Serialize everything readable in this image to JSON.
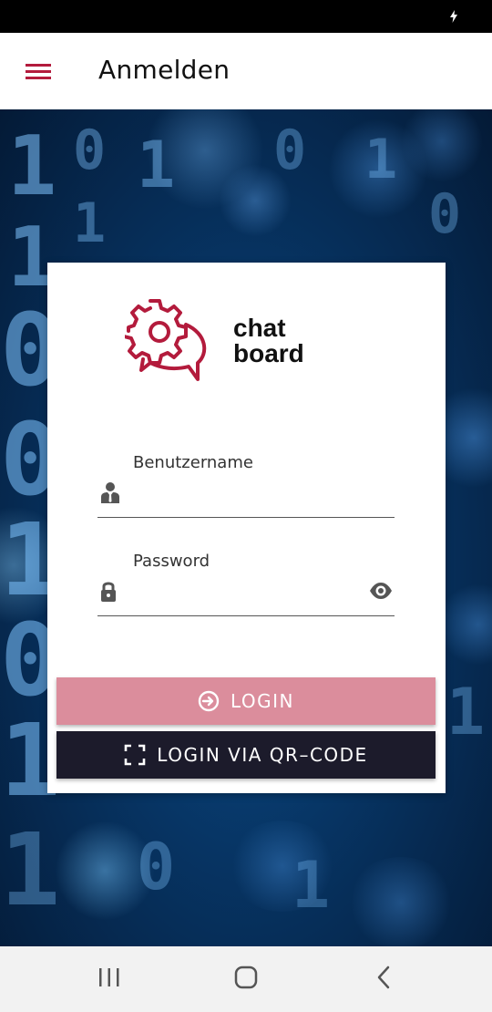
{
  "status_bar": {
    "charging_icon": "bolt-icon"
  },
  "app_bar": {
    "menu_icon": "hamburger-menu-icon",
    "title": "Anmelden"
  },
  "logo": {
    "icon": "gear-chat-bubble-logo-icon",
    "line1": "chat",
    "line2": "board",
    "color": "#b31b3c"
  },
  "form": {
    "username": {
      "label": "Benutzername",
      "value": "",
      "icon": "user-icon"
    },
    "password": {
      "label": "Password",
      "value": "",
      "icon": "lock-icon",
      "toggle_icon": "eye-icon"
    }
  },
  "buttons": {
    "login": {
      "label": "LOGIN",
      "icon": "login-icon",
      "color": "#db8d9c"
    },
    "qr_login": {
      "label": "LOGIN VIA QR–CODE",
      "icon": "qr-scan-icon",
      "color": "#1c1b2b"
    }
  },
  "nav_bar": {
    "recents_icon": "recents-icon",
    "home_icon": "home-icon",
    "back_icon": "back-icon"
  }
}
